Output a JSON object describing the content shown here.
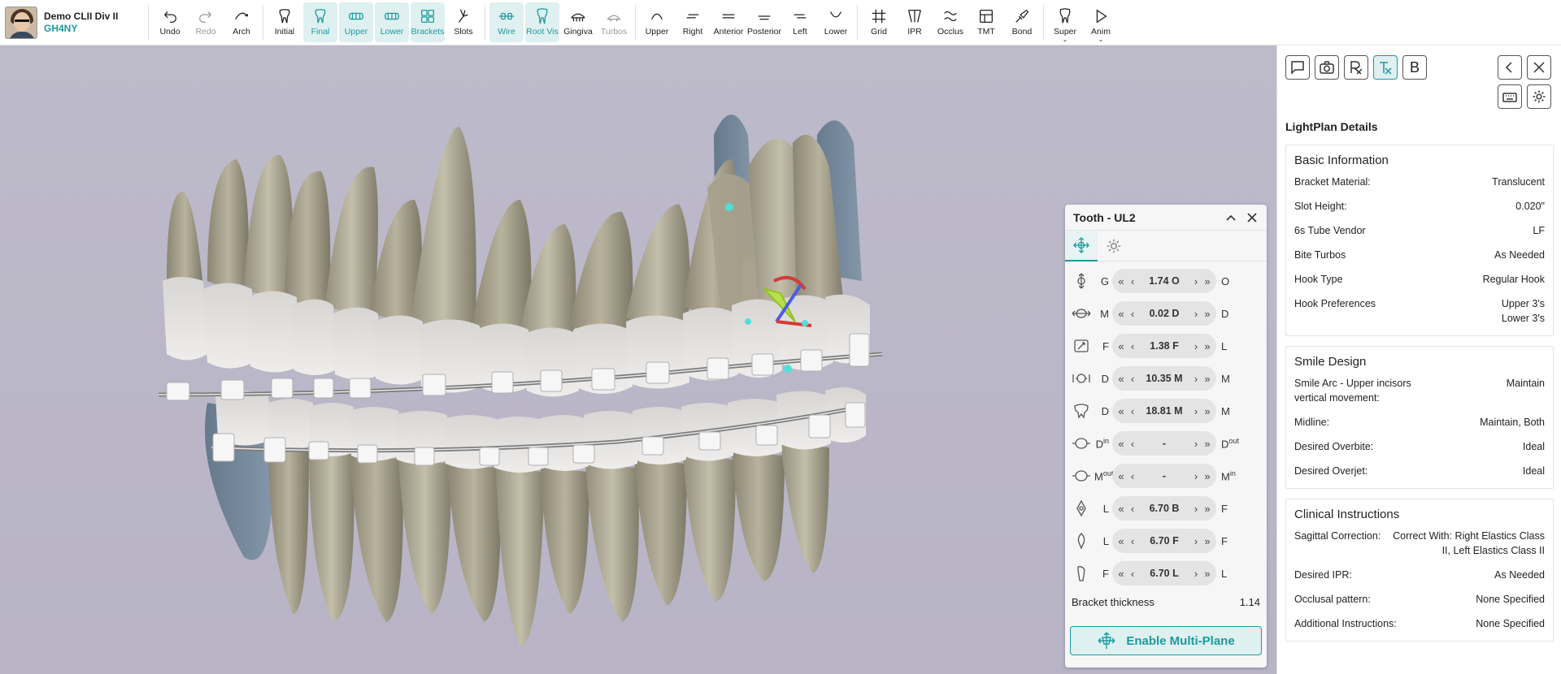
{
  "patient": {
    "name": "Demo CLII Div II",
    "id": "GH4NY"
  },
  "toolbar": {
    "items": [
      {
        "label": "Undo",
        "icon": "undo-icon"
      },
      {
        "label": "Redo",
        "icon": "redo-icon"
      },
      {
        "label": "Arch",
        "icon": "arch-icon"
      },
      {
        "label": "Initial",
        "icon": "tooth-icon"
      },
      {
        "label": "Final",
        "icon": "tooth-icon"
      },
      {
        "label": "Upper",
        "icon": "upper-arch-icon"
      },
      {
        "label": "Lower",
        "icon": "lower-arch-icon"
      },
      {
        "label": "Brackets",
        "icon": "brackets-icon"
      },
      {
        "label": "Slots",
        "icon": "slots-icon"
      },
      {
        "label": "Wire",
        "icon": "wire-icon"
      },
      {
        "label": "Root Vis",
        "icon": "root-icon"
      },
      {
        "label": "Gingiva",
        "icon": "gingiva-icon"
      },
      {
        "label": "Turbos",
        "icon": "turbos-icon"
      },
      {
        "label": "Upper",
        "icon": "view-upper-icon"
      },
      {
        "label": "Right",
        "icon": "view-right-icon"
      },
      {
        "label": "Anterior",
        "icon": "view-anterior-icon"
      },
      {
        "label": "Posterior",
        "icon": "view-posterior-icon"
      },
      {
        "label": "Left",
        "icon": "view-left-icon"
      },
      {
        "label": "Lower",
        "icon": "view-lower-icon"
      },
      {
        "label": "Grid",
        "icon": "grid-icon"
      },
      {
        "label": "IPR",
        "icon": "ipr-icon"
      },
      {
        "label": "Occlus",
        "icon": "occlus-icon"
      },
      {
        "label": "TMT",
        "icon": "tmt-icon"
      },
      {
        "label": "Bond",
        "icon": "bond-icon"
      },
      {
        "label": "Super",
        "icon": "super-icon"
      },
      {
        "label": "Anim",
        "icon": "play-icon"
      }
    ],
    "active_color": "#1a9aa0"
  },
  "tooth_panel": {
    "title": "Tooth - UL2",
    "rows": [
      {
        "left": "G",
        "value": "1.74 O",
        "right": "O"
      },
      {
        "left": "M",
        "value": "0.02 D",
        "right": "D"
      },
      {
        "left": "F",
        "value": "1.38 F",
        "right": "L"
      },
      {
        "left": "D",
        "value": "10.35 M",
        "right": "M"
      },
      {
        "left": "D",
        "value": "18.81 M",
        "right": "M"
      },
      {
        "left": "D",
        "left_sup": "in",
        "value": "-",
        "right": "D",
        "right_sup": "out"
      },
      {
        "left": "M",
        "left_sup": "out",
        "value": "-",
        "right": "M",
        "right_sup": "in"
      },
      {
        "left": "L",
        "value": "6.70 B",
        "right": "F"
      },
      {
        "left": "L",
        "value": "6.70 F",
        "right": "F"
      },
      {
        "left": "F",
        "value": "6.70 L",
        "right": "L"
      }
    ],
    "bracket_thickness_label": "Bracket thickness",
    "bracket_thickness_value": "1.14",
    "enable_label": "Enable Multi-Plane"
  },
  "right_panel": {
    "icon_b_label": "B",
    "title": "LightPlan Details",
    "sections": [
      {
        "heading": "Basic Information",
        "rows": [
          {
            "key": "Bracket Material:",
            "value": "Translucent"
          },
          {
            "key": "Slot Height:",
            "value": "0.020\""
          },
          {
            "key": "6s Tube Vendor",
            "value": "LF"
          },
          {
            "key": "Bite Turbos",
            "value": "As Needed"
          },
          {
            "key": "Hook Type",
            "value": "Regular Hook"
          },
          {
            "key": "Hook Preferences",
            "value": "Upper 3's\nLower 3's"
          }
        ]
      },
      {
        "heading": "Smile Design",
        "rows": [
          {
            "key": "Smile Arc - Upper incisors vertical movement:",
            "value": "Maintain"
          },
          {
            "key": "Midline:",
            "value": "Maintain, Both"
          },
          {
            "key": "Desired Overbite:",
            "value": "Ideal"
          },
          {
            "key": "Desired Overjet:",
            "value": "Ideal"
          }
        ]
      },
      {
        "heading": "Clinical Instructions",
        "rows": [
          {
            "key": "Sagittal Correction:",
            "value": "Correct With: Right Elastics Class II, Left Elastics Class II"
          },
          {
            "key": "Desired IPR:",
            "value": "As Needed"
          },
          {
            "key": "Occlusal pattern:",
            "value": "None Specified"
          },
          {
            "key": "Additional Instructions:",
            "value": "None Specified"
          }
        ]
      }
    ]
  }
}
